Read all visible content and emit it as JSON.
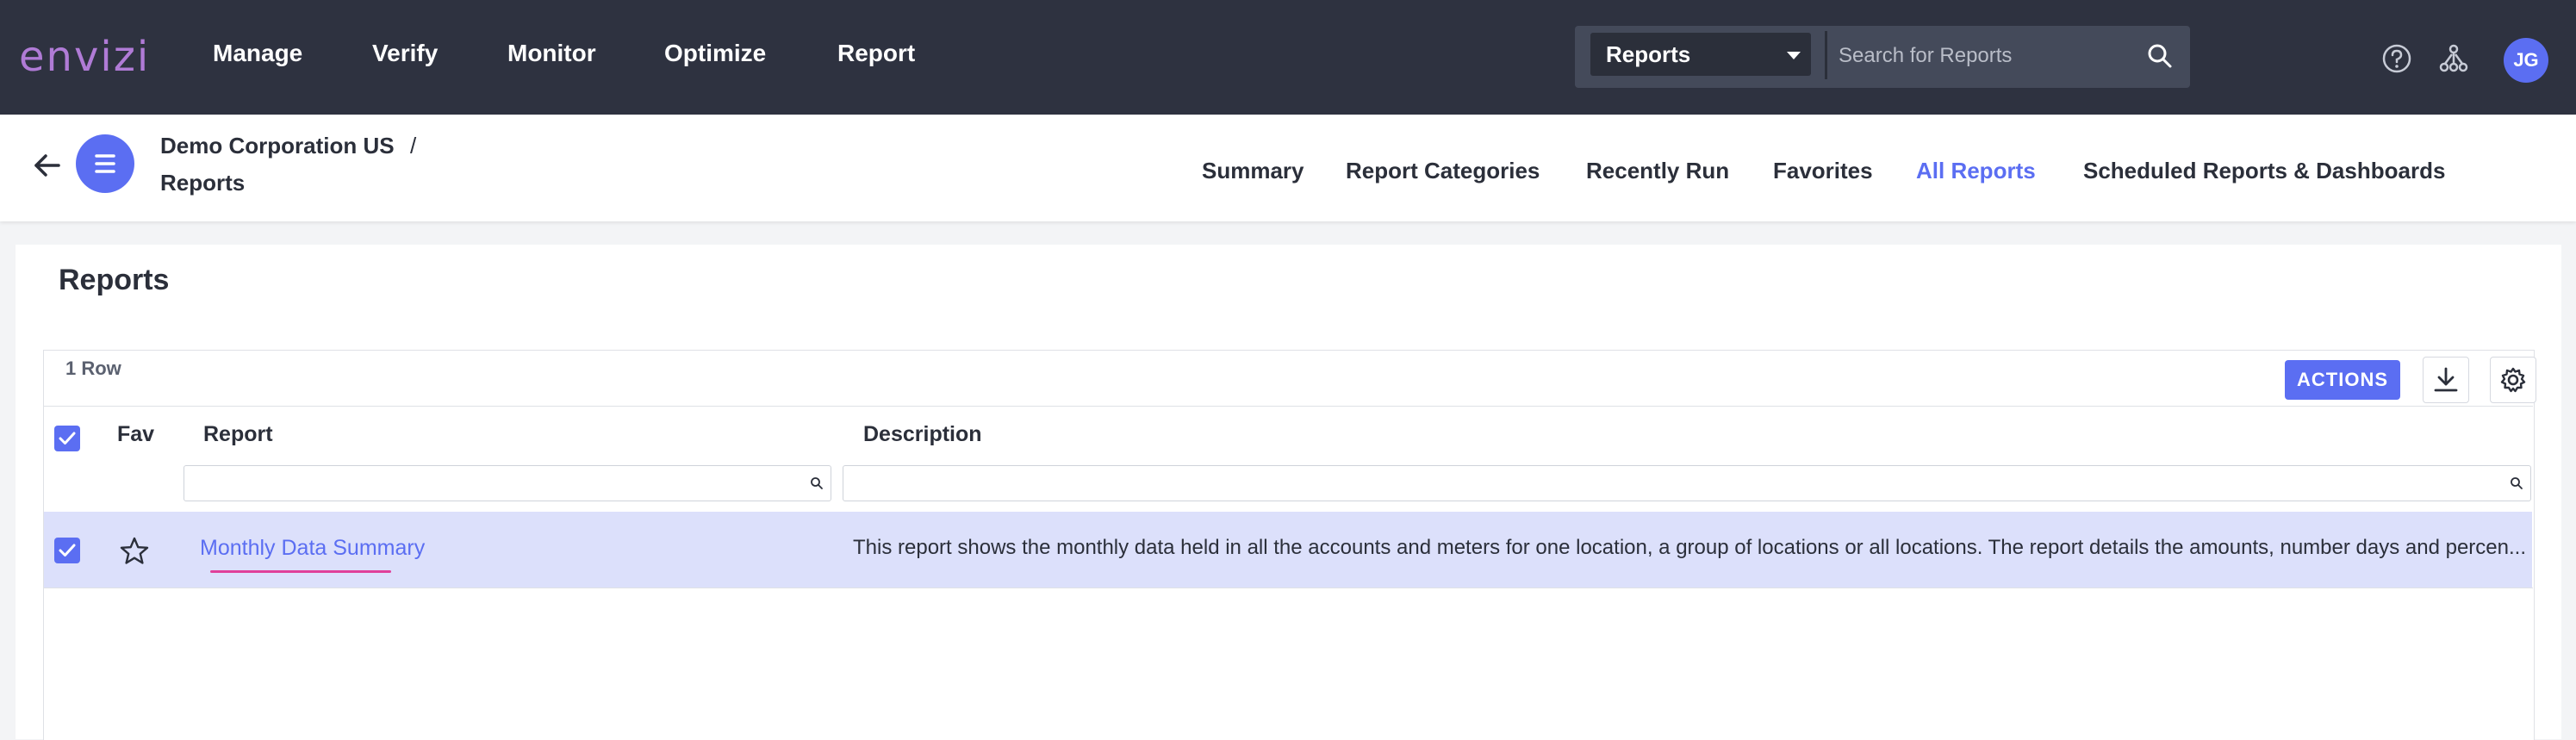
{
  "header": {
    "logo": "envizi",
    "nav": [
      "Manage",
      "Verify",
      "Monitor",
      "Optimize",
      "Report"
    ],
    "search": {
      "scope_selected": "Reports",
      "placeholder": "Search for Reports"
    },
    "user_initials": "JG"
  },
  "breadcrumb": {
    "organization": "Demo Corporation US",
    "separator": "/",
    "current": "Reports"
  },
  "tabs": [
    {
      "label": "Summary",
      "active": false
    },
    {
      "label": "Report Categories",
      "active": false
    },
    {
      "label": "Recently Run",
      "active": false
    },
    {
      "label": "Favorites",
      "active": false
    },
    {
      "label": "All Reports",
      "active": true
    },
    {
      "label": "Scheduled Reports & Dashboards",
      "active": false
    }
  ],
  "page": {
    "title": "Reports",
    "row_count": "1 Row",
    "actions_label": "ACTIONS"
  },
  "table": {
    "columns": [
      "Fav",
      "Report",
      "Description"
    ],
    "rows": [
      {
        "selected": true,
        "favorite": false,
        "report": "Monthly Data Summary",
        "description": "This report shows the monthly data held in all the accounts and meters for one location, a group of locations or all locations. The report details the amounts, number days and percen..."
      }
    ]
  },
  "colors": {
    "topbar": "#2e3240",
    "accent": "#5b6ef2",
    "selected_row": "#dce0fb",
    "logo": "#b07bd6",
    "link_underline": "#e0409a"
  }
}
